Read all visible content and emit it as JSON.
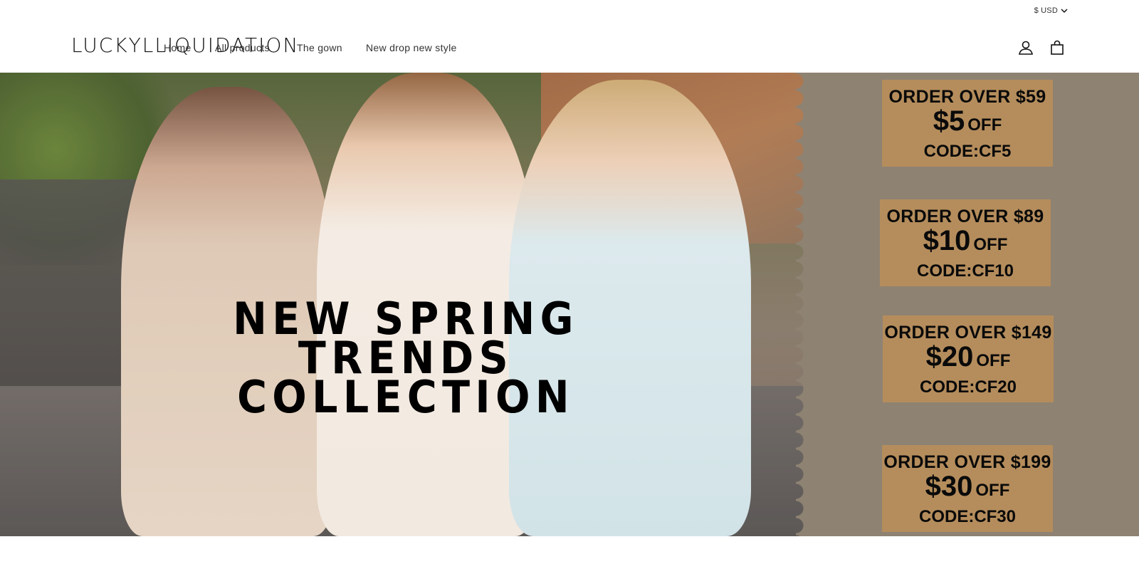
{
  "topbar": {
    "currency_label": "$ USD"
  },
  "header": {
    "logo": "LUCKYLLIQUIDATION",
    "nav": [
      {
        "label": "Home"
      },
      {
        "label": "All products"
      },
      {
        "label": "The gown"
      },
      {
        "label": "New drop new style"
      }
    ],
    "icons": [
      "account-icon",
      "cart-icon"
    ]
  },
  "hero": {
    "title_line1": "NEW SPRING TRENDS",
    "title_line2": "COLLECTION",
    "coupons": [
      {
        "threshold": "ORDER OVER $59",
        "amount": "$5",
        "off": "OFF",
        "code": "CODE:CF5"
      },
      {
        "threshold": "ORDER OVER $89",
        "amount": "$10",
        "off": "OFF",
        "code": "CODE:CF10"
      },
      {
        "threshold": "ORDER OVER $149",
        "amount": "$20",
        "off": "OFF",
        "code": "CODE:CF20"
      },
      {
        "threshold": "ORDER OVER $199",
        "amount": "$30",
        "off": "OFF",
        "code": "CODE:CF30"
      }
    ]
  },
  "colors": {
    "coupon_bg": "#b58d5c",
    "promo_panel_bg": "#8e8272",
    "text": "#121212"
  }
}
